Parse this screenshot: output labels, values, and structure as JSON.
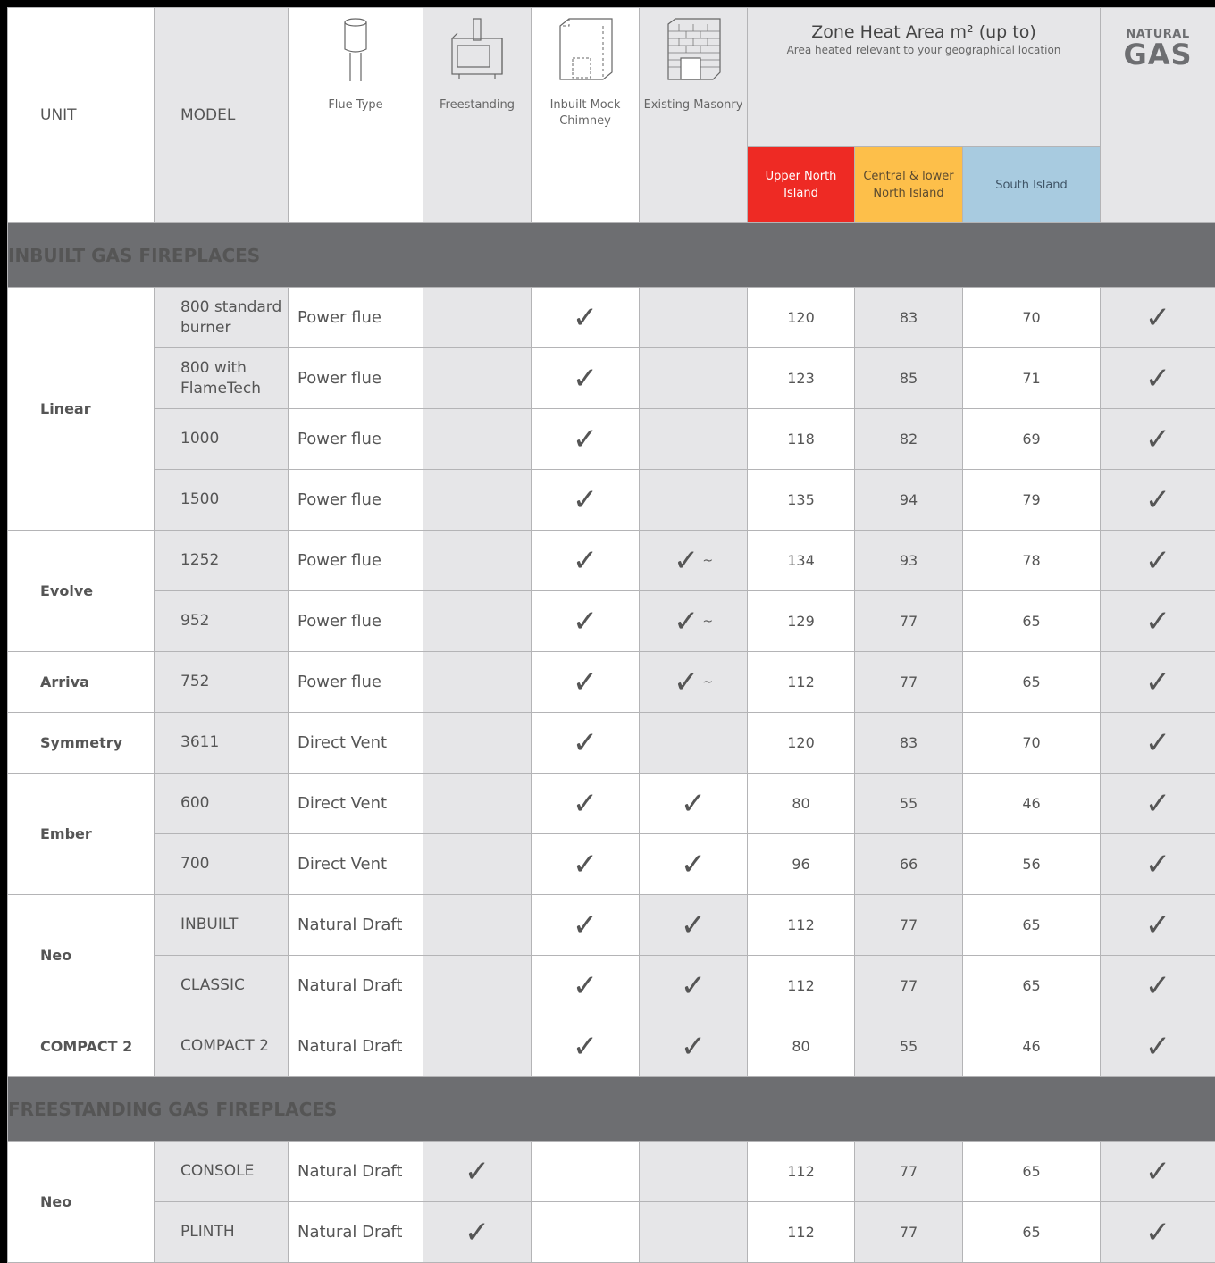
{
  "header": {
    "unit": "UNIT",
    "model": "MODEL",
    "flue_type": "Flue Type",
    "freestanding": "Freestanding",
    "inbuilt_mock_chimney": "Inbuilt Mock Chimney",
    "existing_masonry": "Existing Masonry",
    "zone_title": "Zone Heat Area m² (up to)",
    "zone_subtitle": "Area heated relevant to your geographical location",
    "zone_upper": "Upper North Island",
    "zone_central": "Central & lower North Island",
    "zone_south": "South Island",
    "natural": "NATURAL",
    "gas": "GAS"
  },
  "colors": {
    "upper_north": "#ee2a24",
    "central": "#fdbf4a",
    "south": "#a8cbe0",
    "section_bar": "#6d6e71"
  },
  "check_glyph": "✓",
  "sections": {
    "inbuilt": "INBUILT GAS FIREPLACES",
    "freestanding": "FREESTANDING GAS FIREPLACES"
  },
  "units": {
    "linear": "Linear",
    "evolve": "Evolve",
    "arriva": "Arriva",
    "symmetry": "Symmetry",
    "ember": "Ember",
    "neo": "Neo",
    "compact2": "COMPACT 2",
    "neo_fs": "Neo"
  },
  "rows": [
    {
      "model": "800 standard burner",
      "flue": "Power flue",
      "fs": false,
      "mock": true,
      "mas": "",
      "up": "120",
      "cen": "83",
      "south": "70",
      "gas": true
    },
    {
      "model": "800 with FlameTech",
      "flue": "Power flue",
      "fs": false,
      "mock": true,
      "mas": "",
      "up": "123",
      "cen": "85",
      "south": "71",
      "gas": true
    },
    {
      "model": "1000",
      "flue": "Power flue",
      "fs": false,
      "mock": true,
      "mas": "",
      "up": "118",
      "cen": "82",
      "south": "69",
      "gas": true
    },
    {
      "model": "1500",
      "flue": "Power flue",
      "fs": false,
      "mock": true,
      "mas": "",
      "up": "135",
      "cen": "94",
      "south": "79",
      "gas": true
    },
    {
      "model": "1252",
      "flue": "Power flue",
      "fs": false,
      "mock": true,
      "mas": "~",
      "up": "134",
      "cen": "93",
      "south": "78",
      "gas": true
    },
    {
      "model": "952",
      "flue": "Power flue",
      "fs": false,
      "mock": true,
      "mas": "~",
      "up": "129",
      "cen": "77",
      "south": "65",
      "gas": true
    },
    {
      "model": "752",
      "flue": "Power flue",
      "fs": false,
      "mock": true,
      "mas": "~",
      "up": "112",
      "cen": "77",
      "south": "65",
      "gas": true
    },
    {
      "model": "3611",
      "flue": "Direct Vent",
      "fs": false,
      "mock": true,
      "mas": "",
      "up": "120",
      "cen": "83",
      "south": "70",
      "gas": true
    },
    {
      "model": "600",
      "flue": "Direct Vent",
      "fs": false,
      "mock": true,
      "mas": "yes",
      "up": "80",
      "cen": "55",
      "south": "46",
      "gas": true
    },
    {
      "model": "700",
      "flue": "Direct Vent",
      "fs": false,
      "mock": true,
      "mas": "yes",
      "up": "96",
      "cen": "66",
      "south": "56",
      "gas": true
    },
    {
      "model": "INBUILT",
      "flue": "Natural Draft",
      "fs": false,
      "mock": true,
      "mas": "yes",
      "up": "112",
      "cen": "77",
      "south": "65",
      "gas": true
    },
    {
      "model": "CLASSIC",
      "flue": "Natural Draft",
      "fs": false,
      "mock": true,
      "mas": "yes",
      "up": "112",
      "cen": "77",
      "south": "65",
      "gas": true
    },
    {
      "model": "COMPACT 2",
      "flue": "Natural Draft",
      "fs": false,
      "mock": true,
      "mas": "yes",
      "up": "80",
      "cen": "55",
      "south": "46",
      "gas": true
    },
    {
      "model": "CONSOLE",
      "flue": "Natural Draft",
      "fs": true,
      "mock": false,
      "mas": "",
      "up": "112",
      "cen": "77",
      "south": "65",
      "gas": true
    },
    {
      "model": "PLINTH",
      "flue": "Natural Draft",
      "fs": true,
      "mock": false,
      "mas": "",
      "up": "112",
      "cen": "77",
      "south": "65",
      "gas": true
    }
  ]
}
